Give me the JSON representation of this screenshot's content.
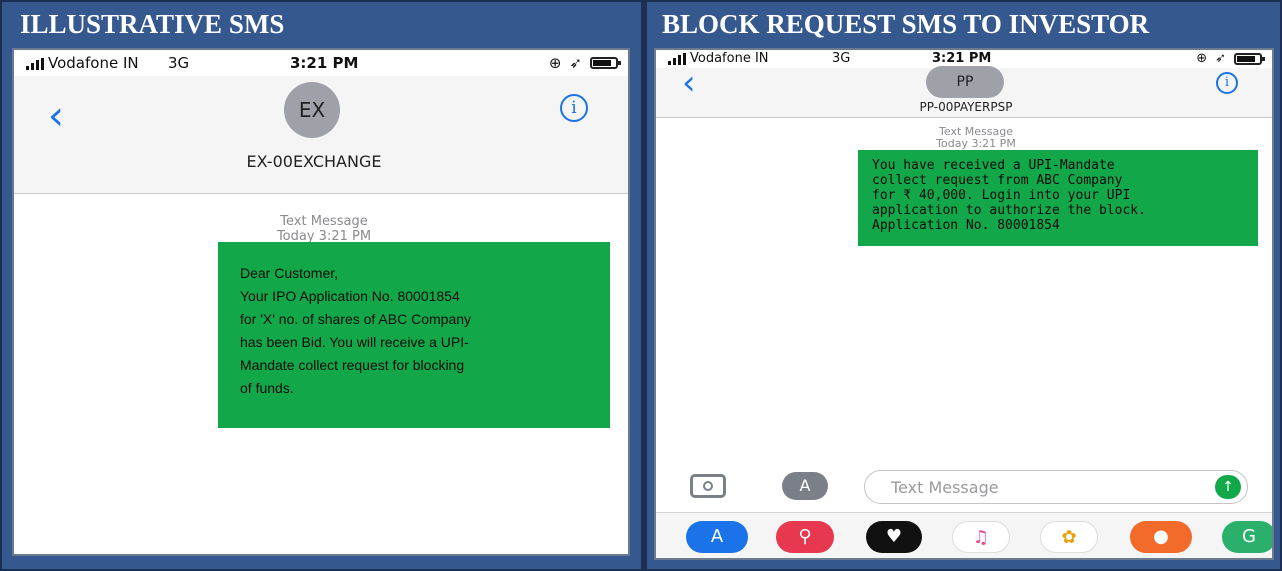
{
  "panels": {
    "left_title": "ILLUSTRATIVE SMS",
    "right_title": "BLOCK REQUEST SMS TO INVESTOR"
  },
  "left_phone": {
    "status": {
      "carrier": "Vodafone IN",
      "network": "3G",
      "time": "3:21 PM"
    },
    "avatar_initials": "EX",
    "sender": "EX-00EXCHANGE",
    "meta_line1": "Text Message",
    "meta_line2": "Today 3:21 PM",
    "message_lines": [
      "Dear Customer,",
      "Your IPO Application No. 80001854",
      "for 'X' no. of shares of ABC Company",
      "has been Bid. You will receive a UPI-",
      "Mandate collect request for blocking",
      "of funds."
    ]
  },
  "right_phone": {
    "status": {
      "carrier": "Vodafone IN",
      "network": "3G",
      "time": "3:21 PM"
    },
    "avatar_initials": "PP",
    "sender": "PP-00PAYERPSP",
    "meta_line1": "Text Message",
    "meta_line2": "Today 3:21 PM",
    "message_lines": [
      "You have received a UPI-Mandate",
      "collect request from ABC Company",
      "for ₹ 40,000. Login into your UPI",
      "application to authorize the block.",
      "Application No. 80001854"
    ],
    "composer_placeholder": "Text Message",
    "dock_icons": [
      "app-store-icon",
      "search-web-icon",
      "heart-icon",
      "music-icon",
      "photos-icon",
      "game-icon",
      "maps-icon"
    ]
  },
  "colors": {
    "frame": "#35588f",
    "bubble": "#12a84a",
    "ios_blue": "#1a73e8"
  }
}
